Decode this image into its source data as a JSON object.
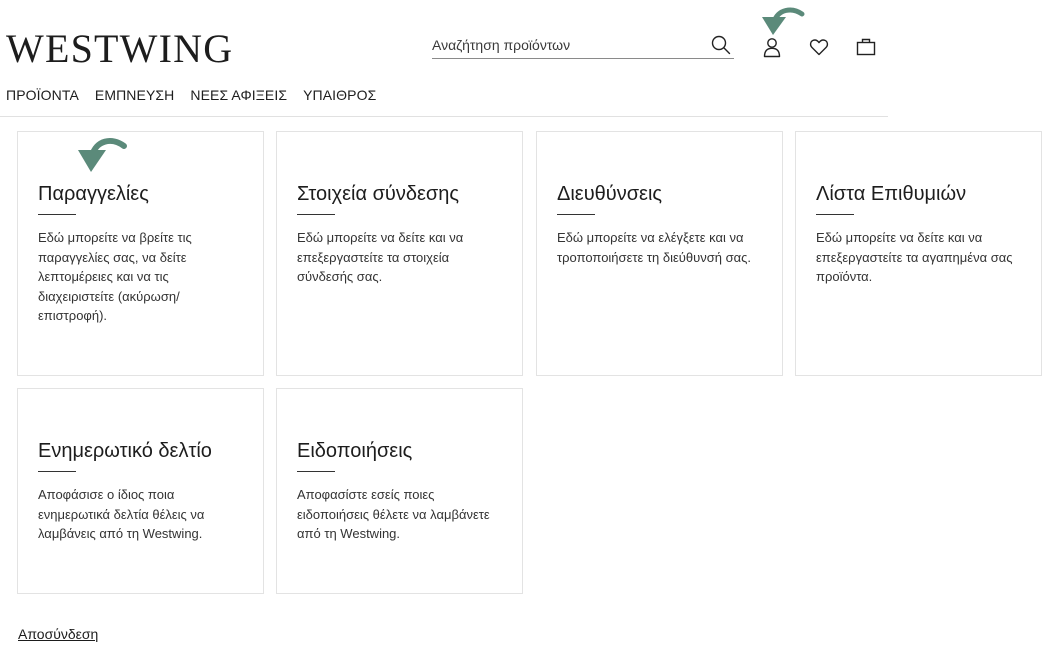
{
  "header": {
    "logo": "WESTWING",
    "search": {
      "placeholder": "Αναζήτηση προϊόντων",
      "value": ""
    }
  },
  "nav": {
    "items": [
      {
        "label": "ΠΡΟΪΟΝΤΑ"
      },
      {
        "label": "ΕΜΠΝΕΥΣΗ"
      },
      {
        "label": "ΝΕΕΣ ΑΦΙΞΕΙΣ"
      },
      {
        "label": "ΥΠΑΙΘΡΟΣ"
      }
    ]
  },
  "cards": [
    {
      "title": "Παραγγελίες",
      "text": "Εδώ μπορείτε να βρείτε τις παραγγελίες σας, να δείτε λεπτομέρειες και να τις διαχειριστείτε (ακύρωση/ επιστροφή)."
    },
    {
      "title": "Στοιχεία σύνδεσης",
      "text": "Εδώ μπορείτε να δείτε και να επεξεργαστείτε τα στοιχεία σύνδεσής σας."
    },
    {
      "title": "Διευθύνσεις",
      "text": "Εδώ μπορείτε να ελέγξετε και να τροποποιήσετε τη διεύθυνσή σας."
    },
    {
      "title": "Λίστα Επιθυμιών",
      "text": "Εδώ μπορείτε να δείτε και να επεξεργαστείτε τα αγαπημένα σας προϊόντα."
    },
    {
      "title": "Ενημερωτικό δελτίο",
      "text": "Αποφάσισε ο ίδιος ποια ενημερωτικά δελτία θέλεις να λαμβάνεις από τη Westwing."
    },
    {
      "title": "Ειδοποιήσεις",
      "text": "Αποφασίστε εσείς ποιες ειδοποιήσεις θέλετε να λαμβάνετε από τη Westwing."
    }
  ],
  "logout": "Αποσύνδεση",
  "colors": {
    "accent_arrow": "#5b8a7a",
    "border": "#e3e3e3",
    "text": "#1d1d1d"
  },
  "icons": [
    "search-icon",
    "user-icon",
    "heart-icon",
    "bag-icon",
    "green-arrow-icon"
  ]
}
